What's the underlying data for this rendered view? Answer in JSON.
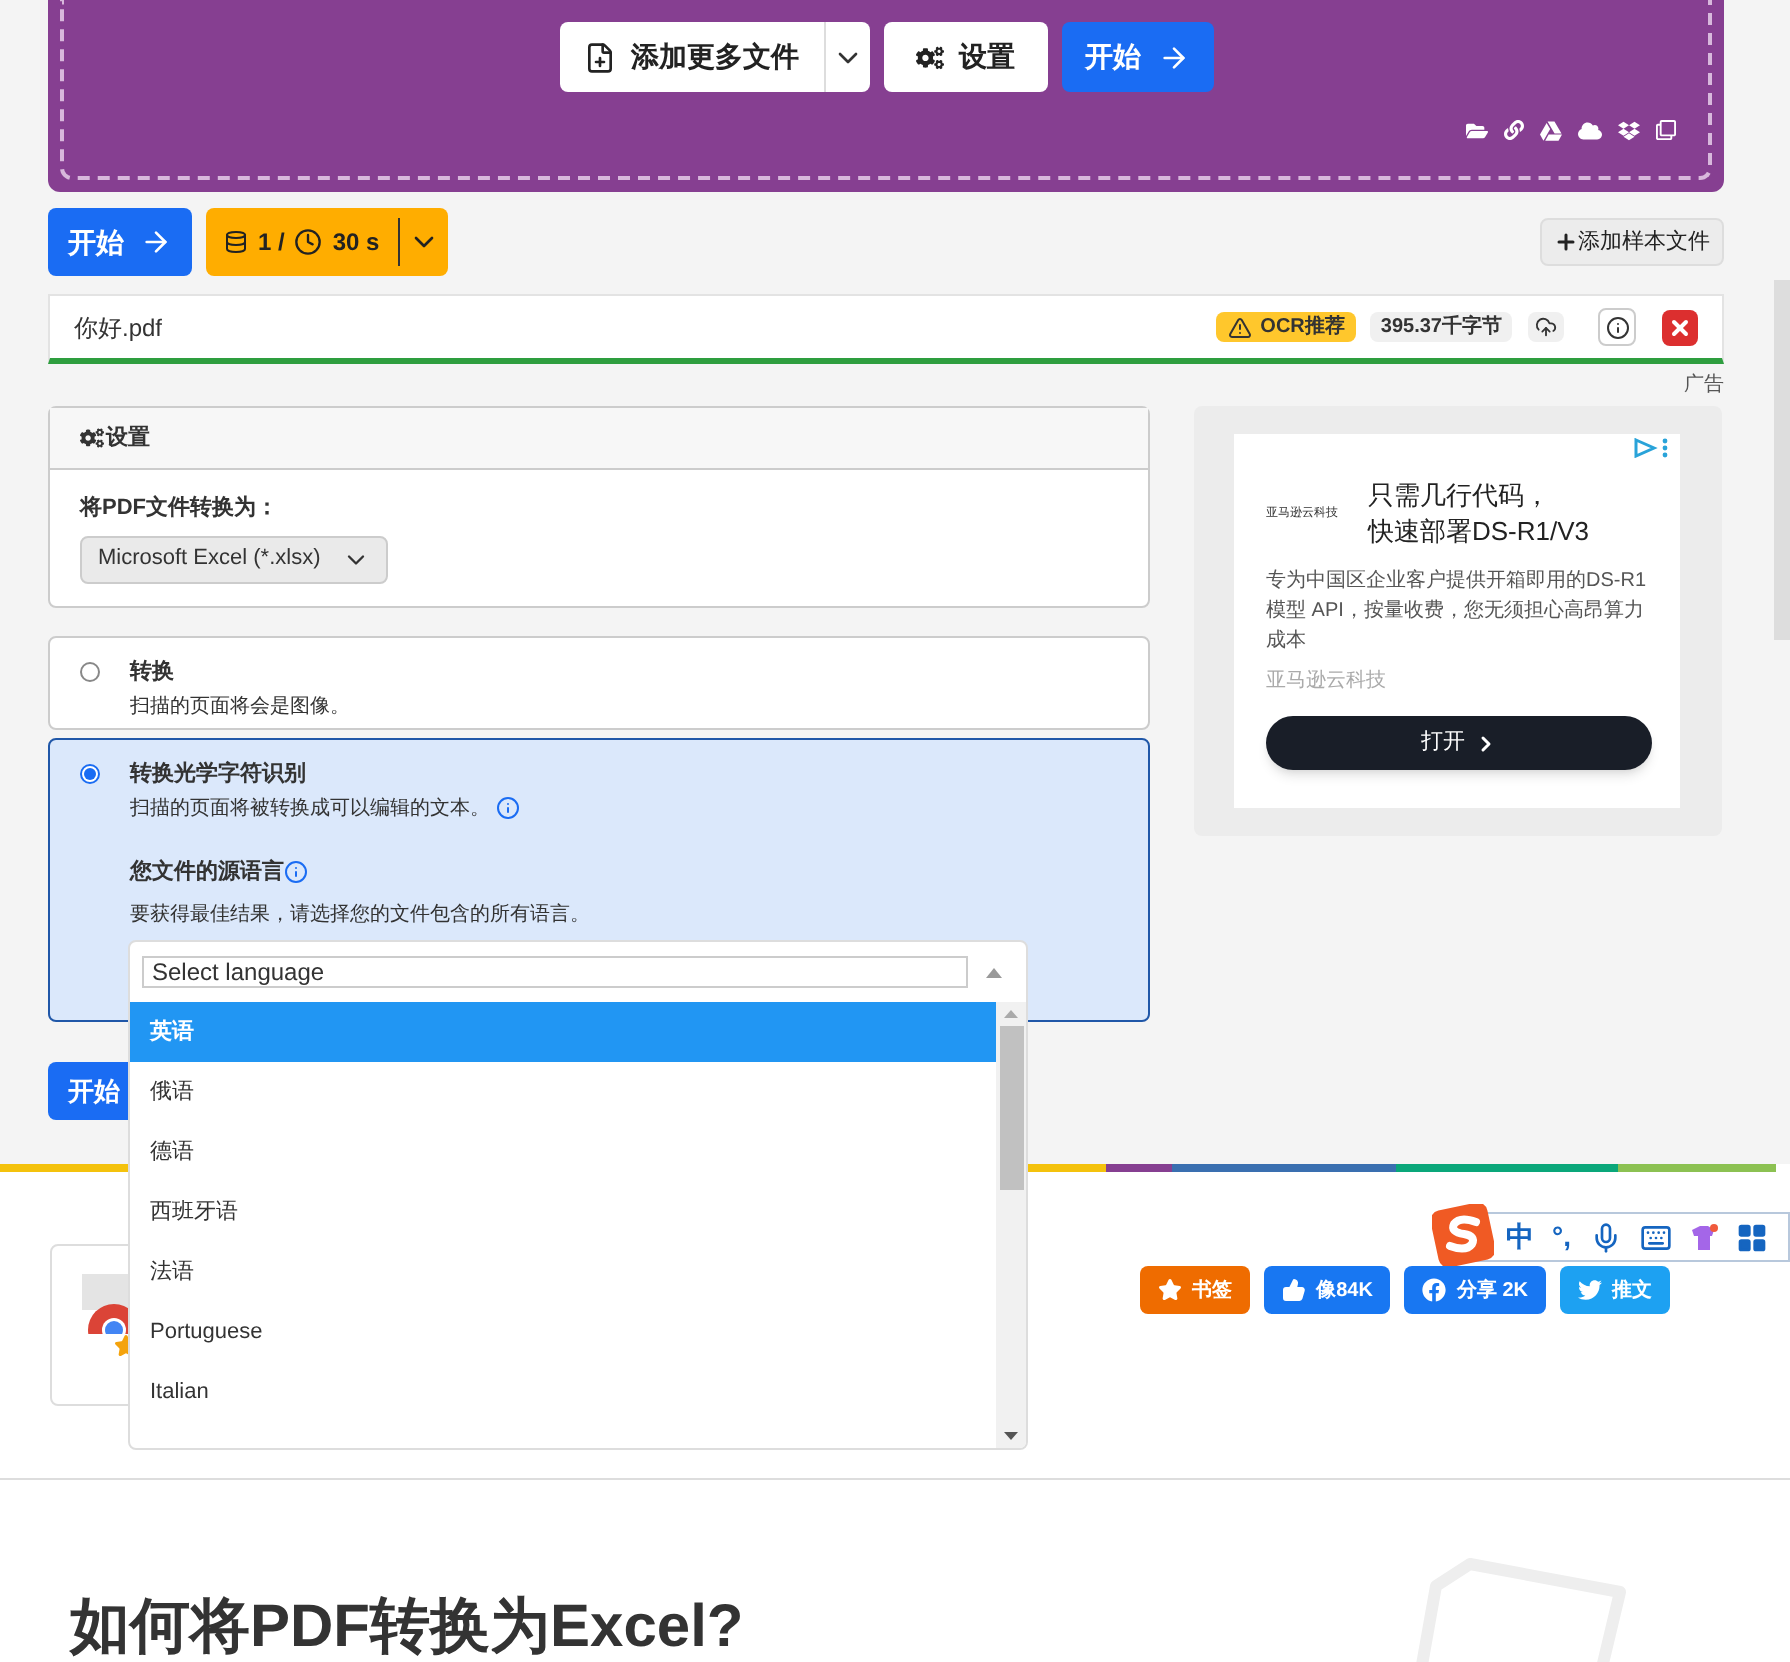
{
  "upload": {
    "add_button": "添加更多文件",
    "settings_button": "设置",
    "start_button": "开始"
  },
  "toolbar": {
    "start_button": "开始",
    "usage": "1 /",
    "time": "30 s",
    "add_sample": "添加样本文件"
  },
  "file": {
    "name": "你好.pdf",
    "ocr_badge": "OCR推荐",
    "size": "395.37千字节"
  },
  "ad_label": "广告",
  "settings": {
    "title": "设置",
    "convert_label": "将PDF文件转换为：",
    "format": "Microsoft Excel (*.xlsx)"
  },
  "modes": [
    {
      "title": "转换",
      "description": "扫描的页面将会是图像。",
      "selected": false
    },
    {
      "title": "转换光学字符识别",
      "description": "扫描的页面将被转换成可以编辑的文本。",
      "selected": true
    }
  ],
  "ocr": {
    "language_title": "您文件的源语言",
    "language_hint": "要获得最佳结果，请选择您的文件包含的所有语言。",
    "placeholder": "Select language"
  },
  "languages": [
    {
      "label": "英语",
      "selected": true
    },
    {
      "label": "俄语",
      "selected": false
    },
    {
      "label": "德语",
      "selected": false
    },
    {
      "label": "西班牙语",
      "selected": false
    },
    {
      "label": "法语",
      "selected": false
    },
    {
      "label": "Portuguese",
      "selected": false
    },
    {
      "label": "Italian",
      "selected": false
    }
  ],
  "bottom_start": "开始",
  "ad": {
    "logo_text": "亚马逊云科技",
    "headline": [
      "只需几行代码，",
      "快速部署DS-R1/V3"
    ],
    "body": "专为中国区企业客户提供开箱即用的DS-R1模型 API，按量收费，您无须担心高昂算力成本",
    "advertiser": "亚马逊云科技",
    "button": "打开"
  },
  "share": [
    {
      "label": "书签",
      "kind": "bookmark"
    },
    {
      "label": "像84K",
      "kind": "like"
    },
    {
      "label": "分享 2K",
      "kind": "share"
    },
    {
      "label": "推文",
      "kind": "tweet"
    }
  ],
  "ime": {
    "mode": "中",
    "punctuation": "°,"
  },
  "heading": "如何将PDF转换为Excel?"
}
